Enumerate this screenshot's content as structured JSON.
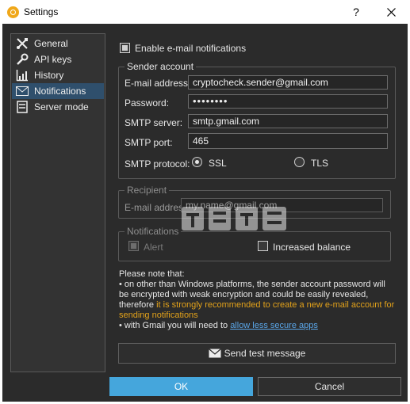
{
  "window": {
    "title": "Settings",
    "help_symbol": "?",
    "close_symbol": "✕"
  },
  "sidebar": {
    "items": [
      {
        "label": "General",
        "icon": "tools-icon",
        "selected": false
      },
      {
        "label": "API keys",
        "icon": "wrench-icon",
        "selected": false
      },
      {
        "label": "History",
        "icon": "chart-icon",
        "selected": false
      },
      {
        "label": "Notifications",
        "icon": "envelope-icon",
        "selected": true
      },
      {
        "label": "Server mode",
        "icon": "server-icon",
        "selected": false
      }
    ]
  },
  "notifications": {
    "enable_email_label": "Enable e-mail notifications",
    "enable_email_checked": true,
    "sender_account": {
      "title": "Sender account",
      "email_label": "E-mail address:",
      "email_value": "cryptocheck.sender@gmail.com",
      "password_label": "Password:",
      "password_value": "••••••••",
      "smtp_server_label": "SMTP server:",
      "smtp_server_value": "smtp.gmail.com",
      "smtp_port_label": "SMTP port:",
      "smtp_port_value": "465",
      "smtp_protocol_label": "SMTP protocol:",
      "protocol_options": [
        "SSL",
        "TLS"
      ],
      "protocol_selected": "SSL"
    },
    "recipient": {
      "title": "Recipient",
      "email_label": "E-mail address:",
      "email_value": "my.name@gmail.com"
    },
    "notify_group": {
      "title": "Notifications",
      "alert_label": "Alert",
      "alert_checked": true,
      "increased_balance_label": "Increased balance",
      "increased_balance_checked": false
    },
    "note": {
      "heading": "Please note that:",
      "line1": "• on other than Windows platforms, the sender account password will be encrypted with weak encryption and could be easily revealed, therefore ",
      "line1_emphasis": "it is strongly recommended to create a new e-mail account for sending notifications",
      "line2_prefix": "• with Gmail you will need to ",
      "line2_link": "allow less secure apps"
    },
    "send_test_label": "Send test message"
  },
  "buttons": {
    "ok": "OK",
    "cancel": "Cancel"
  },
  "watermark": {
    "text": "anxz.com"
  },
  "colors": {
    "background": "#2b2b2b",
    "selected_item": "#2f4f6c",
    "accent_button": "#45a6dc",
    "warning_text": "#e3a21a",
    "link_text": "#5aa6e8"
  }
}
